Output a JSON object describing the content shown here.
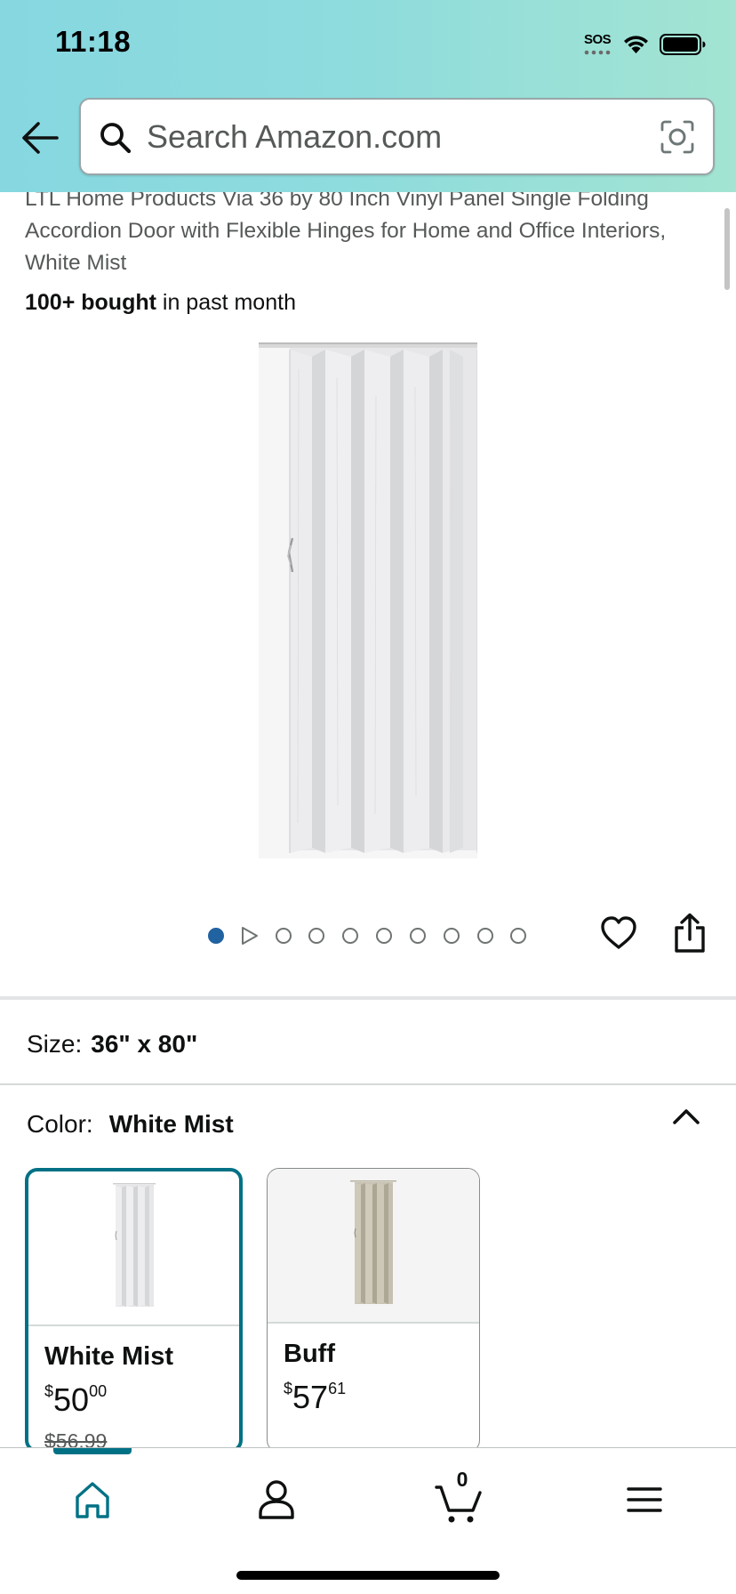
{
  "status_bar": {
    "time": "11:18",
    "sos": "SOS"
  },
  "header": {
    "search_placeholder": "Search Amazon.com",
    "back_icon": "back-arrow-icon",
    "search_icon": "search-icon",
    "camera_icon": "camera-lens-icon"
  },
  "product": {
    "title": "LTL Home Products Via 36 by 80 Inch Vinyl Panel Single Folding Accordion Door with Flexible Hinges for Home and Office Interiors, White Mist",
    "bought_strong": "100+ bought",
    "bought_rest": " in past month",
    "image_count": 10,
    "active_image_index": 0
  },
  "size": {
    "label": "Size:",
    "value": "36\" x 80\""
  },
  "color": {
    "label": "Color:",
    "value": "White Mist",
    "options": [
      {
        "name": "White Mist",
        "price_currency": "$",
        "price_whole": "50",
        "price_fraction": "00",
        "list_price": "$56.99",
        "selected": true
      },
      {
        "name": "Buff",
        "price_currency": "$",
        "price_whole": "57",
        "price_fraction": "61",
        "selected": false
      }
    ]
  },
  "bottom_nav": {
    "items": [
      "home",
      "account",
      "cart",
      "menu"
    ],
    "cart_count": "0",
    "accent": "#007185"
  },
  "colors": {
    "header_gradient_start": "#86d7e0",
    "header_gradient_end": "#a3e4d2",
    "active_dot": "#2162a1",
    "selected_border": "#007185"
  }
}
